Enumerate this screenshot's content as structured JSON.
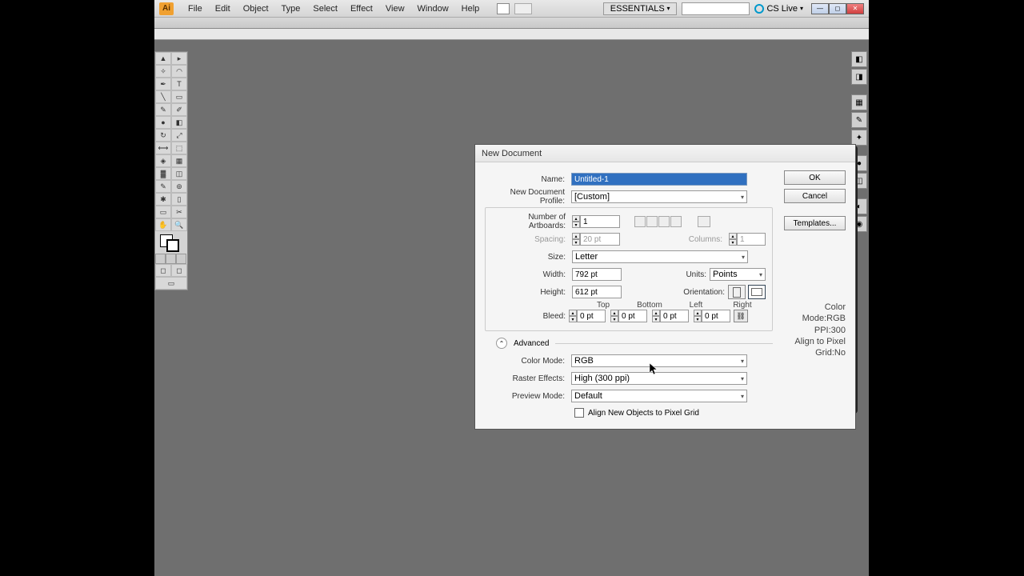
{
  "app": {
    "logo": "Ai"
  },
  "menu": [
    "File",
    "Edit",
    "Object",
    "Type",
    "Select",
    "Effect",
    "View",
    "Window",
    "Help"
  ],
  "workspace": "ESSENTIALS",
  "cslive": "CS Live",
  "dialog": {
    "title": "New Document",
    "labels": {
      "name": "Name:",
      "profile": "New Document Profile:",
      "artboards": "Number of Artboards:",
      "spacing": "Spacing:",
      "columns": "Columns:",
      "size": "Size:",
      "width": "Width:",
      "height": "Height:",
      "units": "Units:",
      "orientation": "Orientation:",
      "bleed": "Bleed:",
      "top": "Top",
      "bottom": "Bottom",
      "left": "Left",
      "right": "Right",
      "advanced": "Advanced",
      "colormode": "Color Mode:",
      "raster": "Raster Effects:",
      "preview": "Preview Mode:",
      "align": "Align New Objects to Pixel Grid"
    },
    "values": {
      "name": "Untitled-1",
      "profile": "[Custom]",
      "artboards": "1",
      "spacing": "20 pt",
      "columns": "1",
      "size": "Letter",
      "width": "792 pt",
      "height": "612 pt",
      "units": "Points",
      "bleed_top": "0 pt",
      "bleed_bottom": "0 pt",
      "bleed_left": "0 pt",
      "bleed_right": "0 pt",
      "colormode": "RGB",
      "raster": "High (300 ppi)",
      "preview": "Default"
    },
    "buttons": {
      "ok": "OK",
      "cancel": "Cancel",
      "templates": "Templates..."
    },
    "info": {
      "cm": "Color Mode:RGB",
      "ppi": "PPI:300",
      "grid": "Align to Pixel Grid:No"
    }
  }
}
